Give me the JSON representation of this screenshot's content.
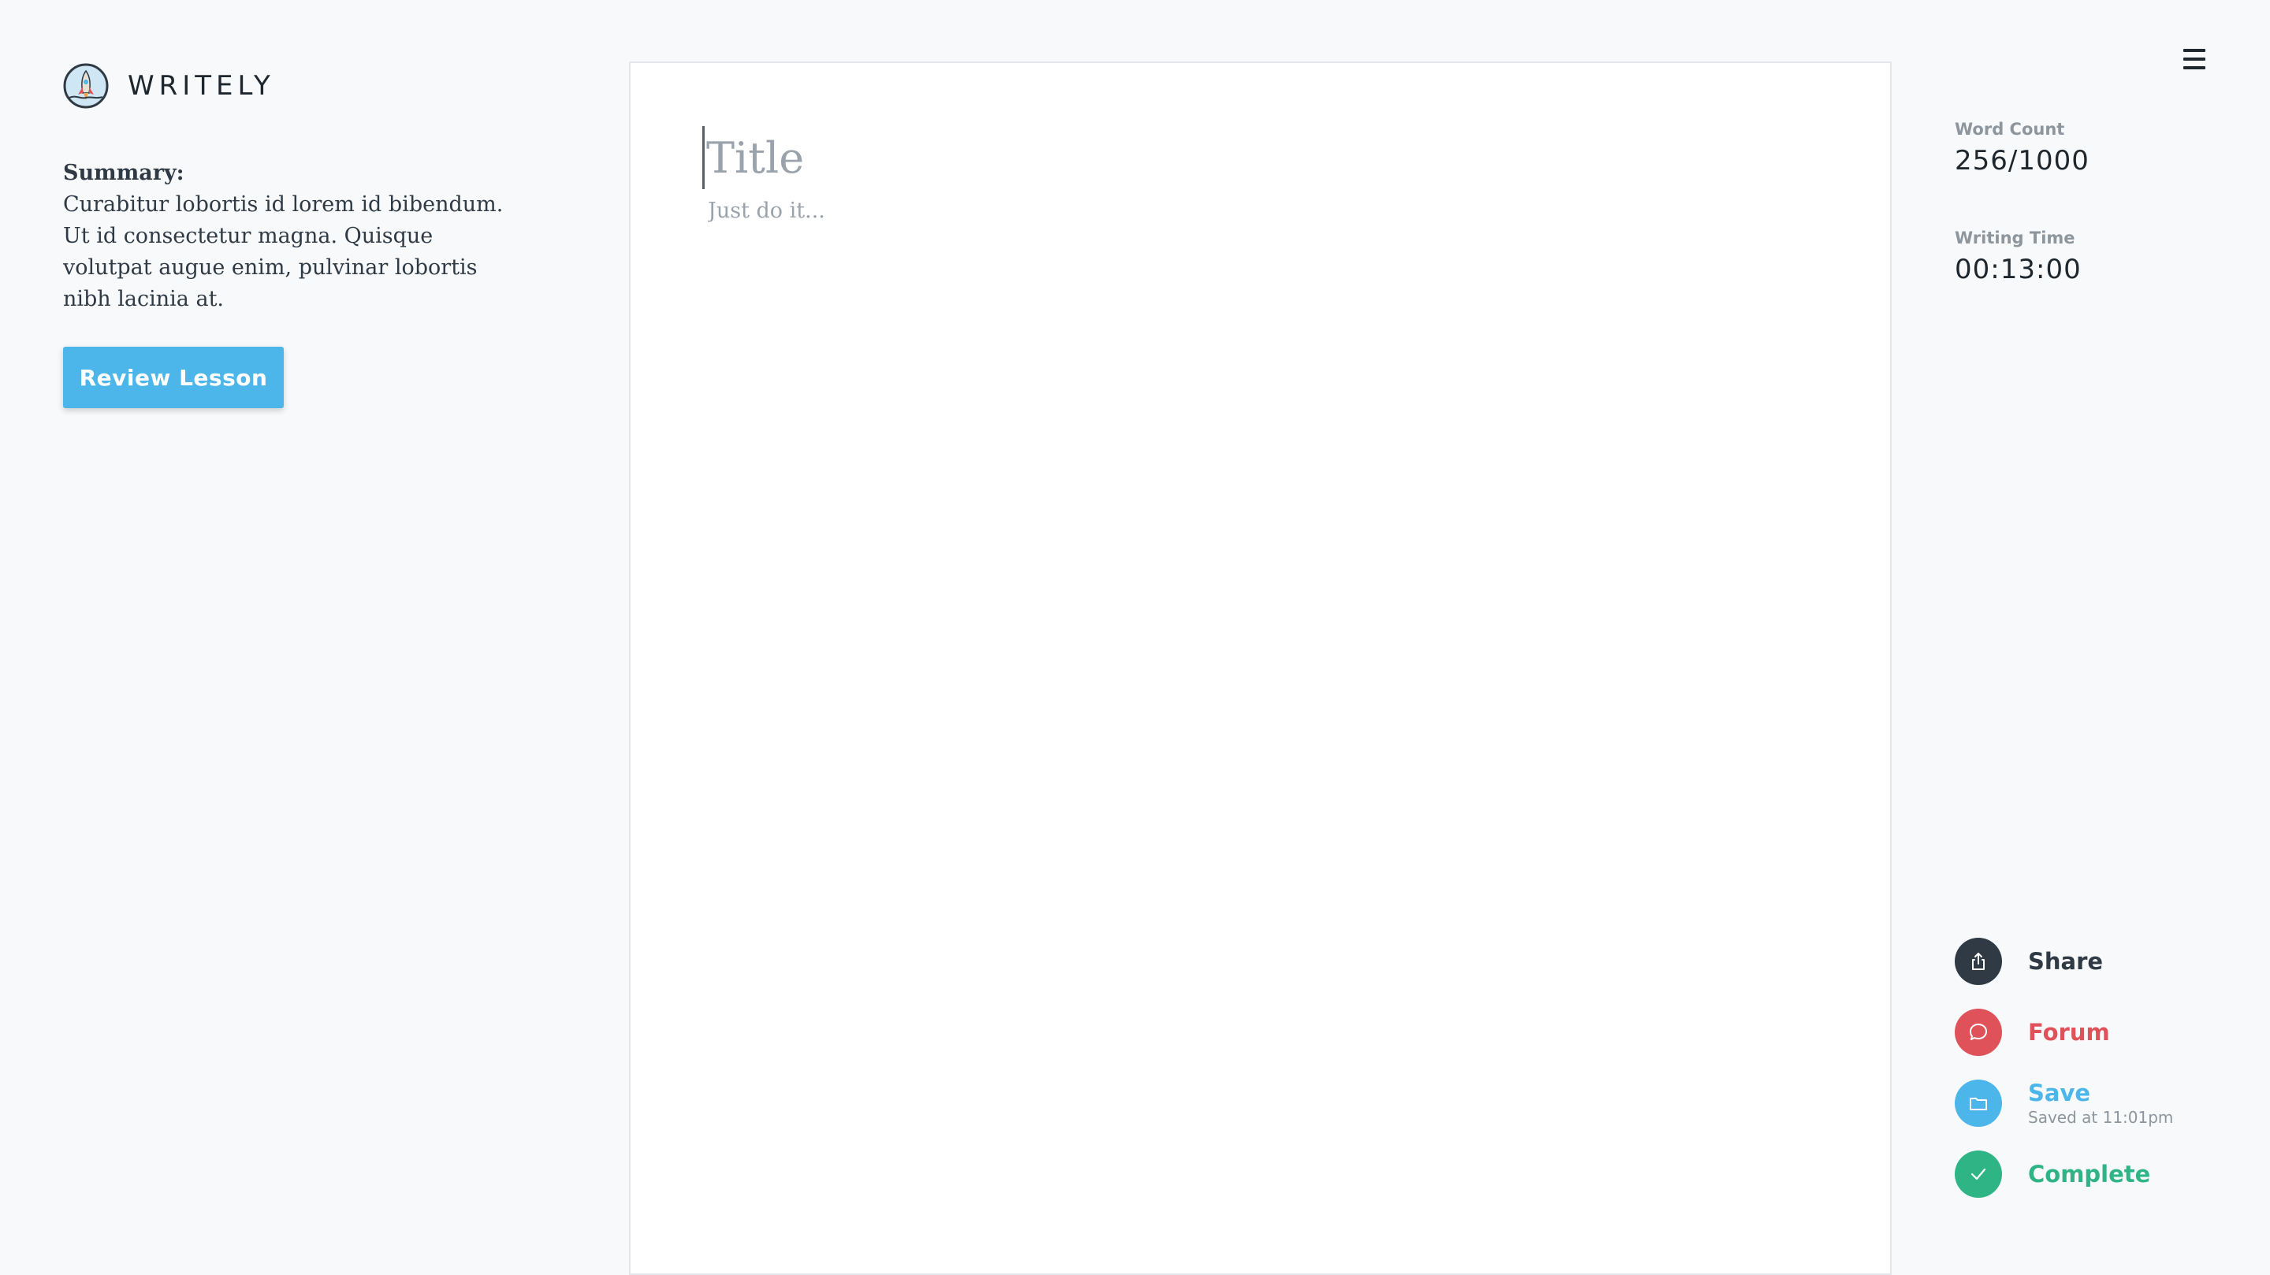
{
  "app": {
    "name": "WRITELY"
  },
  "summary": {
    "label": "Summary:",
    "text": "Curabitur lobortis id lorem id bibendum. Ut id consectetur magna. Quisque volutpat augue enim, pulvinar lobortis nibh lacinia at."
  },
  "review_button": {
    "label": "Review Lesson",
    "color": "#4cb6ea"
  },
  "editor": {
    "title_placeholder": "Title",
    "body_placeholder": "Just do it..."
  },
  "stats": {
    "word_count": {
      "label": "Word Count",
      "value": "256/1000"
    },
    "writing_time": {
      "label": "Writing Time",
      "value": "00:13:00"
    }
  },
  "actions": {
    "share": {
      "label": "Share",
      "color": "#2f3a44",
      "icon": "share-icon"
    },
    "forum": {
      "label": "Forum",
      "color": "#e05259",
      "icon": "chat-bubble-icon"
    },
    "save": {
      "label": "Save",
      "sub": "Saved at 11:01pm",
      "color": "#4cb6ea",
      "icon": "folder-icon"
    },
    "complete": {
      "label": "Complete",
      "color": "#2fb585",
      "icon": "checkmark-icon"
    }
  },
  "menu": {
    "icon": "hamburger-menu-icon"
  }
}
